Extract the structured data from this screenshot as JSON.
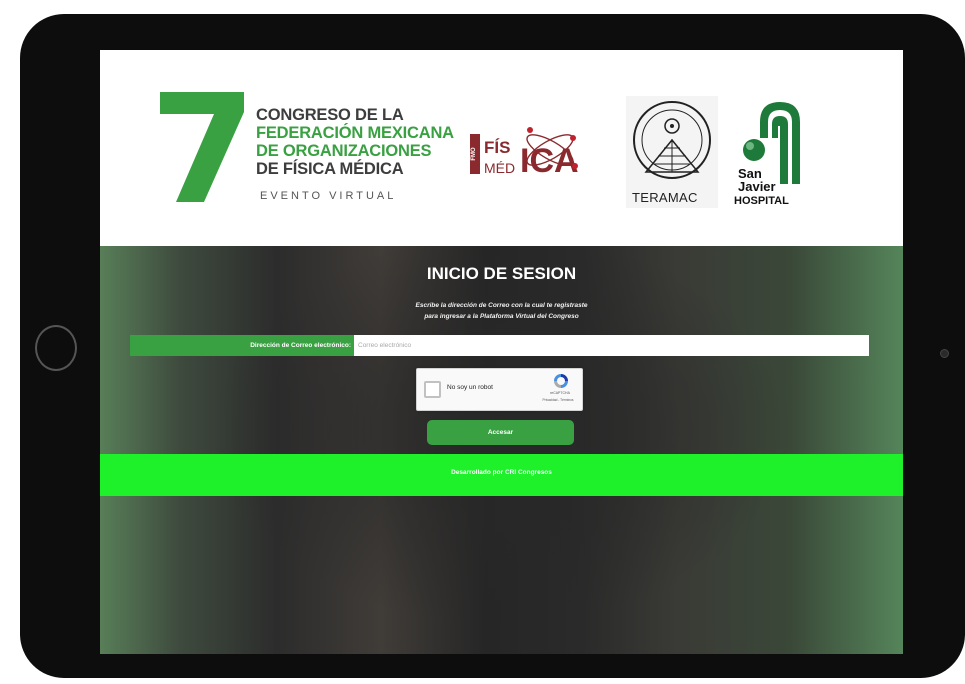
{
  "header": {
    "congreso_line1": "CONGRESO DE LA",
    "congreso_line2": "FEDERACIÓN MEXICANA",
    "congreso_line3": "DE ORGANIZACIONES",
    "congreso_line4": "DE FÍSICA MÉDICA",
    "evento": "EVENTO VIRTUAL",
    "number": "7",
    "fmo_logo": {
      "fmo": "FMO",
      "fis": "FÍS",
      "med": "MÉD",
      "ica": "ICA"
    },
    "teramac_label": "TERAMAC",
    "sanjavier": {
      "line1": "San",
      "line2": "Javier",
      "line3": "HOSPITAL"
    }
  },
  "login": {
    "title": "INICIO DE SESION",
    "subtitle_line1": "Escribe la dirección de Correo con la cual te registraste",
    "subtitle_line2": "para ingresar a la Plataforma Virtual del Congreso",
    "email_label": "Dirección de Correo electrónico:",
    "email_placeholder": "Correo electrónico",
    "email_value": "",
    "captcha_label": "No soy un robot",
    "captcha_brand": "reCAPTCHA",
    "captcha_links": "Privacidad - Términos",
    "access_button": "Accesar"
  },
  "footer": {
    "prefix": "Desarrollado por",
    "link": "CRI Congresos"
  },
  "colors": {
    "brand_green": "#3aa142",
    "footer_green": "#1ef02a",
    "fmo_maroon": "#8a2a2e"
  }
}
